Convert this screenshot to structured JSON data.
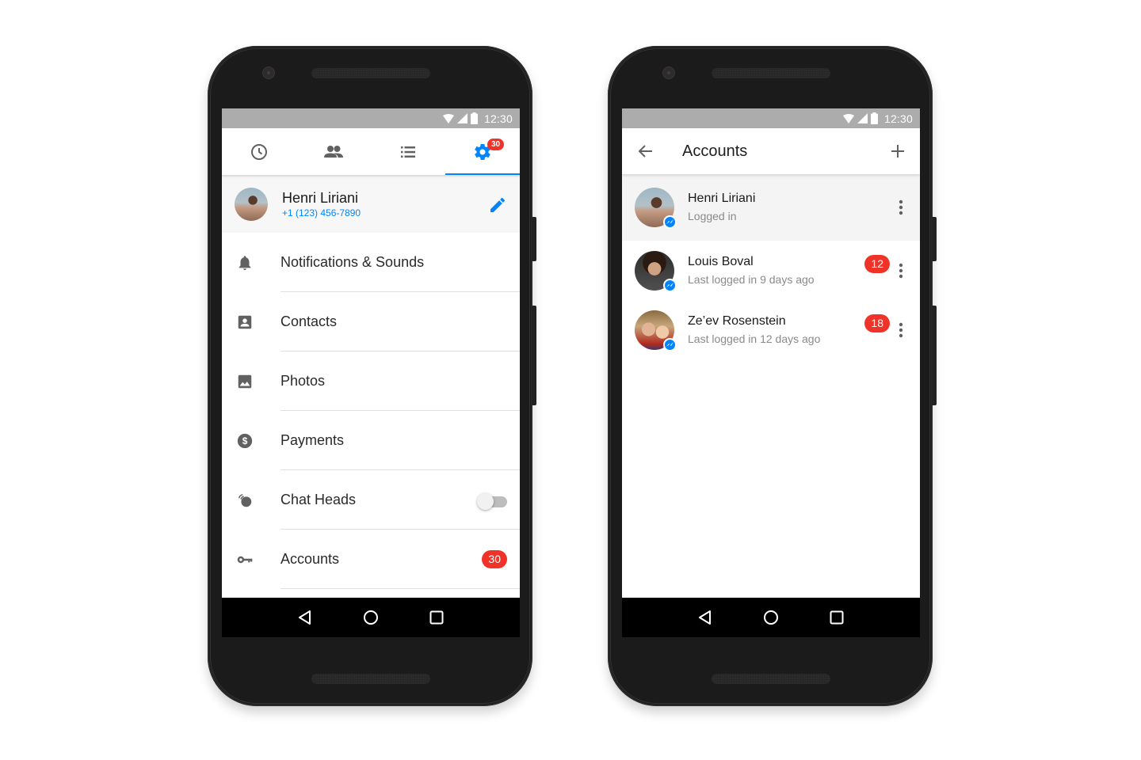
{
  "status_bar": {
    "time": "12:30",
    "icons": [
      "wifi-icon",
      "signal-icon",
      "battery-icon"
    ]
  },
  "left_phone": {
    "tabs": [
      {
        "name": "recent",
        "icon": "clock-icon",
        "active": false
      },
      {
        "name": "people",
        "icon": "people-icon",
        "active": false
      },
      {
        "name": "groups",
        "icon": "list-icon",
        "active": false
      },
      {
        "name": "settings",
        "icon": "gear-icon",
        "active": true,
        "badge": "30"
      }
    ],
    "profile": {
      "name": "Henri Liriani",
      "phone": "+1 (123) 456-7890",
      "edit_icon": "pencil-icon"
    },
    "menu": [
      {
        "label": "Notifications & Sounds",
        "icon": "bell-icon"
      },
      {
        "label": "Contacts",
        "icon": "contact-card-icon"
      },
      {
        "label": "Photos",
        "icon": "image-icon"
      },
      {
        "label": "Payments",
        "icon": "dollar-circle-icon"
      },
      {
        "label": "Chat Heads",
        "icon": "chat-heads-icon",
        "toggle": false
      },
      {
        "label": "Accounts",
        "icon": "key-icon",
        "badge": "30"
      }
    ]
  },
  "right_phone": {
    "appbar": {
      "title": "Accounts",
      "back_icon": "arrow-left-icon",
      "add_icon": "plus-icon"
    },
    "accounts": [
      {
        "name": "Henri Liriani",
        "status": "Logged in",
        "current": true
      },
      {
        "name": "Louis Boval",
        "status": "Last logged in 9 days ago",
        "badge": "12"
      },
      {
        "name": "Ze’ev Rosenstein",
        "status": "Last logged in 12 days ago",
        "badge": "18"
      }
    ]
  },
  "navbar": {
    "buttons": [
      "back-triangle-icon",
      "home-circle-icon",
      "recents-square-icon"
    ]
  },
  "colors": {
    "accent": "#0084ff",
    "badge": "#f03328",
    "status_bar": "#acacac",
    "icon_gray": "#616161"
  }
}
